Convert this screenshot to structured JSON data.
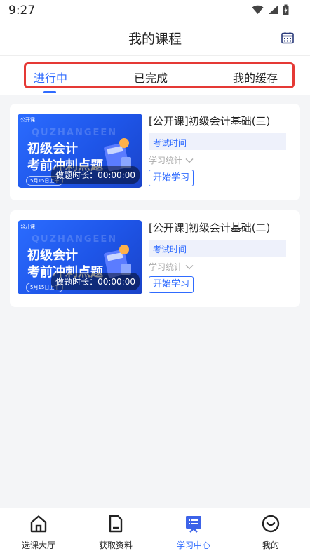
{
  "status_bar": {
    "time": "9:27"
  },
  "header": {
    "title": "我的课程"
  },
  "tabs": [
    {
      "label": "进行中",
      "active": true
    },
    {
      "label": "已完成",
      "active": false
    },
    {
      "label": "我的缓存",
      "active": false
    }
  ],
  "courses": [
    {
      "thumb": {
        "tag": "公开课",
        "watermark": "QUZHANGEEN",
        "line1": "初级会计",
        "line2": "考前冲刺点题",
        "date": "5月15日上午",
        "timer": "做题时长：00:00:00"
      },
      "title": "[公开课]初级会计基础(三)",
      "exam_time": "考试时间",
      "stats": "学习统计",
      "start": "开始学习"
    },
    {
      "thumb": {
        "tag": "公开课",
        "watermark": "QUZHANGEEN",
        "line1": "初级会计",
        "line2": "考前冲刺点题",
        "date": "5月15日上午",
        "timer": "做题时长：00:00:00"
      },
      "title": "[公开课]初级会计基础(二)",
      "exam_time": "考试时间",
      "stats": "学习统计",
      "start": "开始学习"
    }
  ],
  "bottom_nav": [
    {
      "label": "选课大厅",
      "icon": "home-icon",
      "active": false
    },
    {
      "label": "获取资料",
      "icon": "document-icon",
      "active": false
    },
    {
      "label": "学习中心",
      "icon": "study-center-icon",
      "active": true
    },
    {
      "label": "我的",
      "icon": "smile-icon",
      "active": false
    }
  ],
  "colors": {
    "accent": "#2f6bff",
    "highlight_border": "#e53935"
  }
}
